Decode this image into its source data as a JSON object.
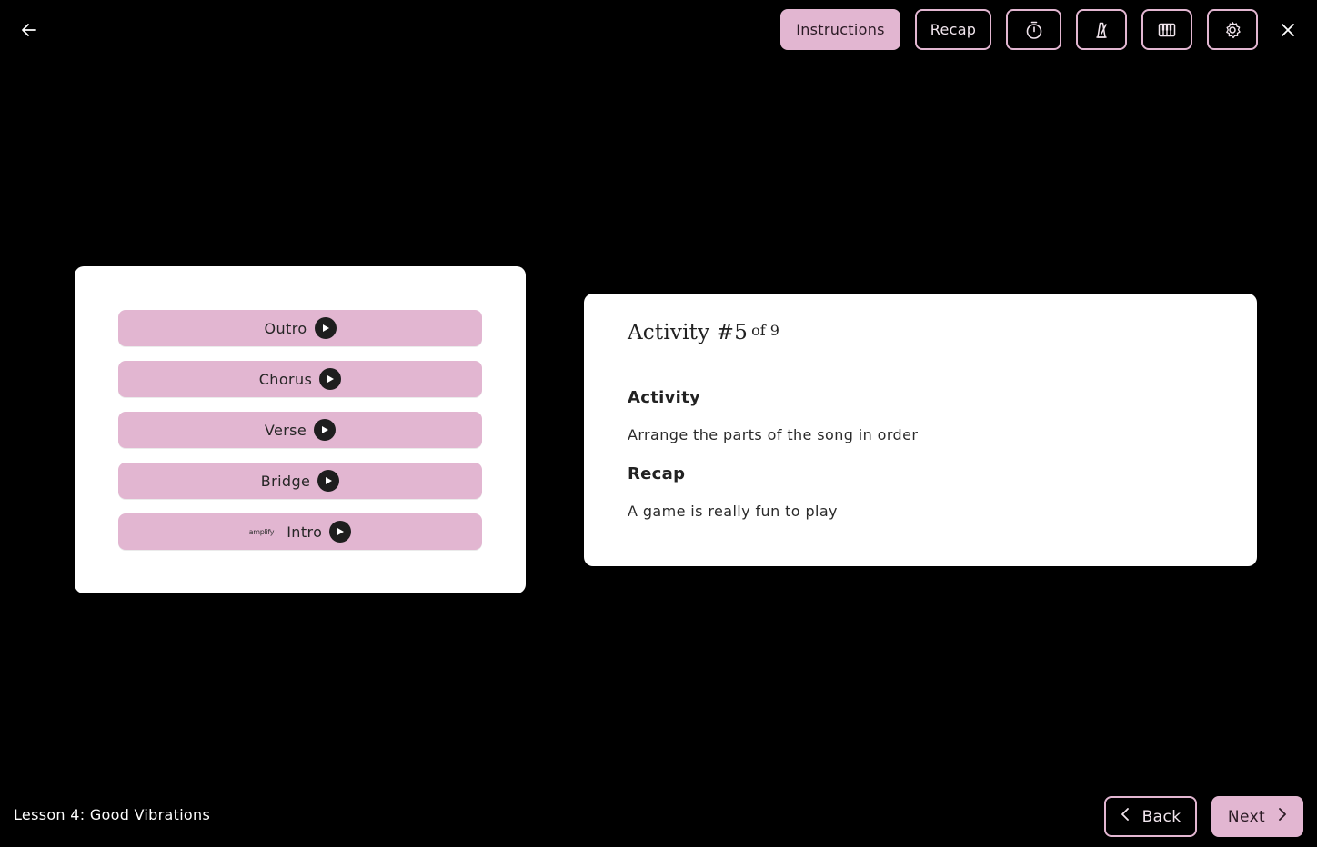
{
  "toolbar": {
    "instructions_label": "Instructions",
    "recap_label": "Recap",
    "icons": [
      "back-arrow-icon",
      "timer-icon",
      "metronome-icon",
      "piano-icon",
      "gear-icon",
      "close-icon"
    ]
  },
  "song_parts": [
    {
      "label": "Outro",
      "play_icon": "play-icon"
    },
    {
      "label": "Chorus",
      "play_icon": "play-icon"
    },
    {
      "label": "Verse",
      "play_icon": "play-icon"
    },
    {
      "label": "Bridge",
      "play_icon": "play-icon"
    },
    {
      "label": "Intro",
      "play_icon": "play-icon",
      "logo_text": "amplify"
    }
  ],
  "activity": {
    "title": "Activity #5",
    "of_total": "of 9",
    "activity_heading": "Activity",
    "activity_text": "Arrange the parts of the song in order",
    "recap_heading": "Recap",
    "recap_text": "A game is really fun to play"
  },
  "footer": {
    "lesson_label": "Lesson 4: Good Vibrations",
    "back_label": "Back",
    "next_label": "Next"
  },
  "colors": {
    "accent": "#e2b6d1",
    "background": "#000000",
    "card": "#ffffff"
  }
}
